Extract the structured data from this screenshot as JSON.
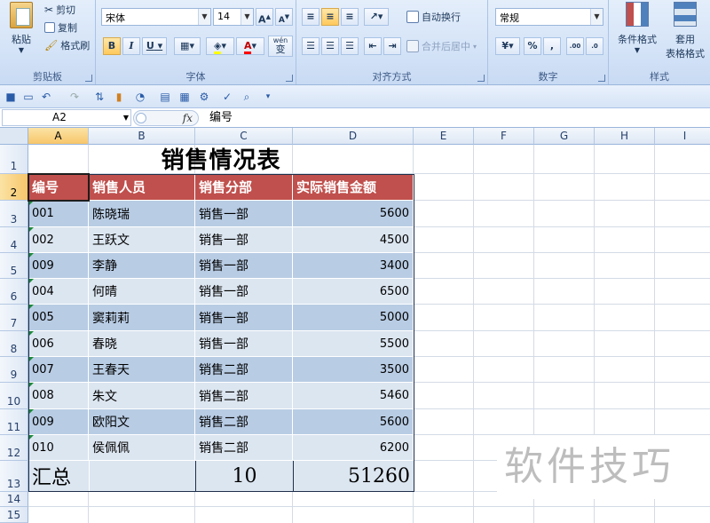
{
  "ribbon": {
    "clipboard": {
      "label": "剪贴板",
      "paste": "粘贴",
      "cut": "剪切",
      "copy": "复制",
      "format_painter": "格式刷"
    },
    "font": {
      "label": "字体",
      "name": "宋体",
      "size": "14",
      "bold": "B",
      "italic": "I",
      "underline": "U",
      "grow": "A",
      "shrink": "A",
      "wen": "wén",
      "wen_char": "变"
    },
    "alignment": {
      "label": "对齐方式",
      "wrap": "自动换行",
      "merge": "合并后居中"
    },
    "number": {
      "label": "数字",
      "format": "常规",
      "percent": "%",
      "comma": ",",
      "inc": ".00",
      "dec": ".0"
    },
    "styles": {
      "label": "样式",
      "conditional": "条件格式",
      "table_format_1": "套用",
      "table_format_2": "表格格式"
    }
  },
  "formula_bar": {
    "cell_ref": "A2",
    "fx": "fx",
    "value": "编号"
  },
  "columns": [
    "A",
    "B",
    "C",
    "D",
    "E",
    "F",
    "G",
    "H",
    "I"
  ],
  "rows": [
    "1",
    "2",
    "3",
    "4",
    "5",
    "6",
    "7",
    "8",
    "9",
    "10",
    "11",
    "12",
    "13",
    "14",
    "15"
  ],
  "sheet": {
    "title": "销售情况表",
    "headers": [
      "编号",
      "销售人员",
      "销售分部",
      "实际销售金额"
    ],
    "records": [
      [
        "001",
        "陈晓瑞",
        "销售一部",
        "5600"
      ],
      [
        "002",
        "王跃文",
        "销售一部",
        "4500"
      ],
      [
        "009",
        "李静",
        "销售一部",
        "3400"
      ],
      [
        "004",
        "何晴",
        "销售一部",
        "6500"
      ],
      [
        "005",
        "窦莉莉",
        "销售一部",
        "5000"
      ],
      [
        "006",
        "春晓",
        "销售一部",
        "5500"
      ],
      [
        "007",
        "王春天",
        "销售二部",
        "3500"
      ],
      [
        "008",
        "朱文",
        "销售二部",
        "5460"
      ],
      [
        "009",
        "欧阳文",
        "销售二部",
        "5600"
      ],
      [
        "010",
        "侯佩佩",
        "销售二部",
        "6200"
      ]
    ],
    "total": {
      "label": "汇总",
      "count": "10",
      "sum": "51260"
    }
  },
  "watermark": "软件技巧",
  "colors": {
    "header_fill": "#c0504d",
    "band_dark": "#b8cce4",
    "band_light": "#dce6f1"
  }
}
